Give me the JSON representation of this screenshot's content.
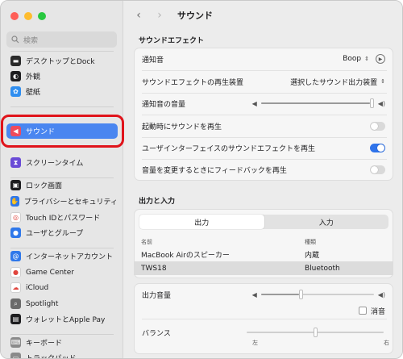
{
  "window": {
    "title": "サウンド",
    "nav": {
      "back": "‹",
      "forward": "›"
    }
  },
  "sidebar": {
    "search_placeholder": "検索",
    "items": [
      {
        "label": "デスクトップとDock",
        "icon": "dock-icon",
        "color": "#2a2a2a",
        "glyph": "▬"
      },
      {
        "label": "外観",
        "icon": "appearance-icon",
        "color": "#1d1d1f",
        "glyph": "◐"
      },
      {
        "label": "壁紙",
        "icon": "wallpaper-icon",
        "color": "#2f8ef0",
        "glyph": "✿"
      },
      {
        "label": "サウンド",
        "icon": "speaker-icon",
        "color": "#f04a5c",
        "glyph": "◀"
      },
      {
        "label": "スクリーンタイム",
        "icon": "hourglass-icon",
        "color": "#6a4bd6",
        "glyph": "⧗"
      },
      {
        "label": "ロック画面",
        "icon": "lock-icon",
        "color": "#1d1d1f",
        "glyph": "▣"
      },
      {
        "label": "プライバシーとセキュリティ",
        "icon": "hand-icon",
        "color": "#2f78ea",
        "glyph": "✋"
      },
      {
        "label": "Touch IDとパスワード",
        "icon": "fingerprint-icon",
        "color": "#ffffff",
        "glyph": "◎"
      },
      {
        "label": "ユーザとグループ",
        "icon": "users-icon",
        "color": "#2f78ea",
        "glyph": "●"
      },
      {
        "label": "インターネットアカウント",
        "icon": "at-icon",
        "color": "#2f78ea",
        "glyph": "@"
      },
      {
        "label": "Game Center",
        "icon": "game-center-icon",
        "color": "#ffffff",
        "glyph": "●"
      },
      {
        "label": "iCloud",
        "icon": "cloud-icon",
        "color": "#ffffff",
        "glyph": "☁"
      },
      {
        "label": "Spotlight",
        "icon": "spotlight-icon",
        "color": "#6b6b6b",
        "glyph": "⌕"
      },
      {
        "label": "ウォレットとApple Pay",
        "icon": "wallet-icon",
        "color": "#1d1d1f",
        "glyph": "▤"
      },
      {
        "label": "キーボード",
        "icon": "keyboard-icon",
        "color": "#8a8a8a",
        "glyph": "⌨"
      },
      {
        "label": "トラックパッド",
        "icon": "trackpad-icon",
        "color": "#8a8a8a",
        "glyph": "▭"
      }
    ]
  },
  "sound_effects": {
    "section_title": "サウンドエフェクト",
    "alert_sound_label": "通知音",
    "alert_sound_value": "Boop",
    "play_output_label": "サウンドエフェクトの再生装置",
    "play_output_value": "選択したサウンド出力装置",
    "alert_volume_label": "通知音の音量",
    "alert_volume_level": 1.0,
    "startup_label": "起動時にサウンドを再生",
    "startup_on": false,
    "ui_effects_label": "ユーザインターフェイスのサウンドエフェクトを再生",
    "ui_effects_on": true,
    "feedback_label": "音量を変更するときにフィードバックを再生",
    "feedback_on": false
  },
  "output_input": {
    "section_title": "出力と入力",
    "tabs": [
      "出力",
      "入力"
    ],
    "active_tab": 0,
    "columns": [
      "名前",
      "種類"
    ],
    "devices": [
      {
        "name": "MacBook Airのスピーカー",
        "type": "内蔵",
        "selected": false
      },
      {
        "name": "TWS18",
        "type": "Bluetooth",
        "selected": true
      }
    ],
    "output_volume_label": "出力音量",
    "output_volume_level": 0.35,
    "mute_label": "消音",
    "muted": false,
    "balance_label": "バランス",
    "balance_level": 0.5,
    "balance_left": "左",
    "balance_right": "右"
  },
  "colors": {
    "accent": "#2f73ea",
    "sidebar_active": "#4a86f0",
    "highlight_ring": "#e0141b"
  }
}
